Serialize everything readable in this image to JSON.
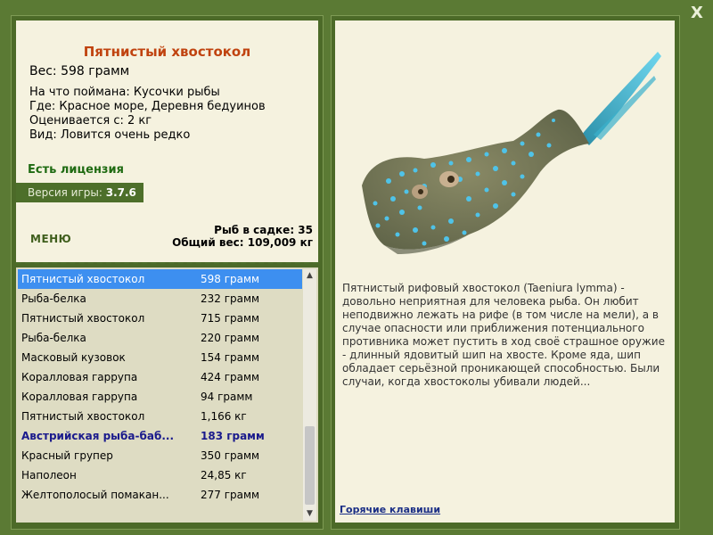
{
  "header": {
    "close_label": "X"
  },
  "fish": {
    "title": "Пятнистый хвостокол",
    "weight": "Вес: 598 грамм",
    "bait": "На что поймана: Кусочки рыбы",
    "place": "Где: Красное море, Деревня бедуинов",
    "value": "Оценивается с: 2 кг",
    "rarity": "Вид: Ловится очень редко"
  },
  "license": "Есть лицензия",
  "version": {
    "label": "Версия игры:",
    "number": "3.7.6"
  },
  "menu_label": "МЕНЮ",
  "stats": {
    "fish_count": "Рыб в садке: 35",
    "total_weight": "Общий вес: 109,009 кг"
  },
  "catch_list": [
    {
      "name": "Пятнистый хвостокол",
      "weight": "598 грамм",
      "selected": true
    },
    {
      "name": "Рыба-белка",
      "weight": "232 грамм"
    },
    {
      "name": "Пятнистый хвостокол",
      "weight": "715 грамм"
    },
    {
      "name": "Рыба-белка",
      "weight": "220 грамм"
    },
    {
      "name": "Масковый кузовок",
      "weight": "154 грамм"
    },
    {
      "name": "Коралловая гаррупа",
      "weight": "424 грамм"
    },
    {
      "name": "Коралловая гаррупа",
      "weight": "94 грамм"
    },
    {
      "name": "Пятнистый хвостокол",
      "weight": "1,166 кг"
    },
    {
      "name": "Австрийская рыба-баб...",
      "weight": "183 грамм",
      "bold": true
    },
    {
      "name": "Красный групер",
      "weight": "350 грамм"
    },
    {
      "name": "Наполеон",
      "weight": "24,85 кг"
    },
    {
      "name": "Желтополосый помакан...",
      "weight": "277 грамм"
    }
  ],
  "description": "Пятнистый рифовый хвостокол (Taeniura lymma) - довольно неприятная для человека рыба. Он любит неподвижно лежать на рифе (в том числе на мели), а в случае опасности или приближения потенциального противника может пустить в ход своё страшное оружие - длинный ядовитый шип на хвосте. Кроме яда, шип обладает серьёзной проникающей способностью. Были случаи, когда хвостоколы убивали людей...",
  "hotkeys_label": "Горячие клавиши",
  "colors": {
    "background": "#5b7a34",
    "panel": "#f5f2df",
    "title": "#c0430f",
    "selection": "#3d8ff0",
    "link": "#1b2f86"
  }
}
